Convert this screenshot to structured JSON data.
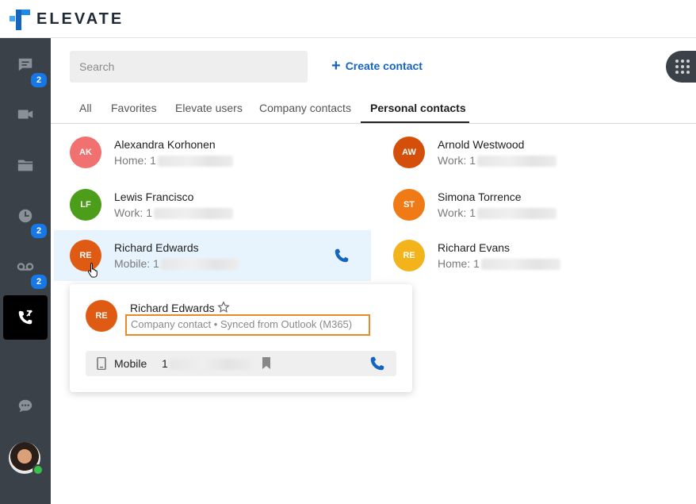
{
  "app": {
    "brand": "ELEVATE"
  },
  "colors": {
    "accent": "#1565c0",
    "sidebar": "#3b4149",
    "badge": "#1677e6",
    "highlight": "#e8892b"
  },
  "sidebar": {
    "items": [
      {
        "name": "chat",
        "icon": "chat-icon",
        "badge": "2"
      },
      {
        "name": "meetings",
        "icon": "video-icon",
        "badge": ""
      },
      {
        "name": "files",
        "icon": "folder-icon",
        "badge": ""
      },
      {
        "name": "history",
        "icon": "clock-icon",
        "badge": "2"
      },
      {
        "name": "voicemail",
        "icon": "voicemail-icon",
        "badge": "2"
      },
      {
        "name": "contacts",
        "icon": "contacts-phone-icon",
        "badge": "",
        "active": true
      },
      {
        "name": "messages",
        "icon": "speech-bubble-icon",
        "badge": ""
      }
    ],
    "presence": "online"
  },
  "search": {
    "placeholder": "Search"
  },
  "create_contact": {
    "label": "Create contact"
  },
  "tabs": [
    {
      "label": "All"
    },
    {
      "label": "Favorites"
    },
    {
      "label": "Elevate users"
    },
    {
      "label": "Company contacts"
    },
    {
      "label": "Personal contacts",
      "active": true
    }
  ],
  "contacts": [
    {
      "initials": "AK",
      "name": "Alexandra Korhonen",
      "phone_label": "Home: 1",
      "color": "#f17070"
    },
    {
      "initials": "AW",
      "name": "Arnold Westwood",
      "phone_label": "Work: 1",
      "color": "#d4500a"
    },
    {
      "initials": "LF",
      "name": "Lewis Francisco",
      "phone_label": "Work: 1",
      "color": "#4c9e1a"
    },
    {
      "initials": "ST",
      "name": "Simona Torrence",
      "phone_label": "Work: 1",
      "color": "#f07a16"
    },
    {
      "initials": "RE",
      "name": "Richard Edwards",
      "phone_label": "Mobile: 1",
      "color": "#df5a12"
    },
    {
      "initials": "RE",
      "name": "Richard Evans",
      "phone_label": "Home: 1",
      "color": "#f2b31b"
    }
  ],
  "card": {
    "initials": "RE",
    "name": "Richard Edwards",
    "meta": "Company contact • Synced from Outlook (M365)",
    "phone_type": "Mobile",
    "phone_prefix": "1"
  }
}
